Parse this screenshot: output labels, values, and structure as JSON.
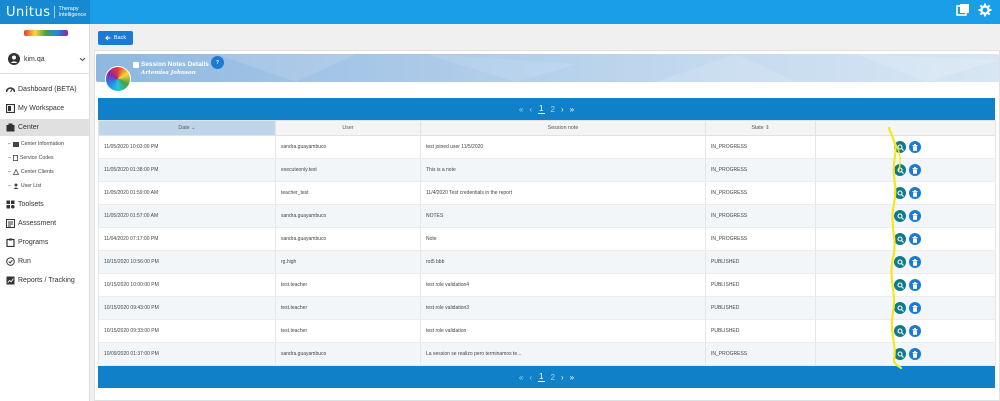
{
  "brand": {
    "name": "Unitus",
    "sub_line1": "Therapy",
    "sub_line2": "Intelligence"
  },
  "sidebar": {
    "username": "kim.qa",
    "items": [
      {
        "label": "Dashboard (BETA)",
        "icon": "dashboard-icon"
      },
      {
        "label": "My Workspace",
        "icon": "workspace-icon"
      },
      {
        "label": "Center",
        "icon": "center-icon"
      },
      {
        "label": "Toolsets",
        "icon": "toolsets-icon"
      },
      {
        "label": "Assessment",
        "icon": "assessment-icon"
      },
      {
        "label": "Programs",
        "icon": "programs-icon"
      },
      {
        "label": "Run",
        "icon": "run-icon"
      },
      {
        "label": "Reports / Tracking",
        "icon": "reports-icon"
      }
    ],
    "center_subitems": [
      {
        "label": "Center Information"
      },
      {
        "label": "Service Codes"
      },
      {
        "label": "Center Clients"
      },
      {
        "label": "User List"
      }
    ]
  },
  "toolbar": {
    "back_label": "Back"
  },
  "header": {
    "title": "Session Notes Details",
    "patient": "Artemisa Johnson",
    "help": "?"
  },
  "pagination": {
    "first": "«",
    "prev": "‹",
    "pages": [
      "1",
      "2"
    ],
    "next": "›",
    "last": "»"
  },
  "table": {
    "columns": {
      "date": "Date",
      "user": "User",
      "note": "Session note",
      "state": "State"
    },
    "rows": [
      {
        "date": "11/05/2020 10:03:00 PM",
        "user": "sandra.guayambuco",
        "note": "test joined user 11/5/2020",
        "state": "IN_PROGRESS"
      },
      {
        "date": "11/05/2020 01:38:00 PM",
        "user": "executeonly.test",
        "note": "This is a note",
        "state": "IN_PROGRESS"
      },
      {
        "date": "11/05/2020 01:59:00 AM",
        "user": "teacher_test",
        "note": "11/4/2020 Test credentials in the report",
        "state": "IN_PROGRESS"
      },
      {
        "date": "11/05/2020 01:57:00 AM",
        "user": "sandra.guayambuco",
        "note": "NOTES",
        "state": "IN_PROGRESS"
      },
      {
        "date": "11/04/2020 07:17:00 PM",
        "user": "sandra.guayambuco",
        "note": "Note",
        "state": "IN_PROGRESS"
      },
      {
        "date": "10/15/2020 10:56:00 PM",
        "user": "rg.high",
        "note": "rot5 bbb",
        "state": "PUBLISHED"
      },
      {
        "date": "10/15/2020 10:00:00 PM",
        "user": "test.teacher",
        "note": "test role validation4",
        "state": "PUBLISHED"
      },
      {
        "date": "10/15/2020 09:43:00 PM",
        "user": "test.teacher",
        "note": "test role validation3",
        "state": "PUBLISHED"
      },
      {
        "date": "10/15/2020 09:33:00 PM",
        "user": "test.teacher",
        "note": "test role validation",
        "state": "PUBLISHED"
      },
      {
        "date": "10/09/2020 01:37:00 PM",
        "user": "sandra.guayambuco",
        "note": "La session se realizo pero terminamos te...",
        "state": "IN_PROGRESS"
      }
    ]
  },
  "colors": {
    "topbar": "#1b9ee8",
    "pager": "#1080c8",
    "view_button": "#0e7b8a",
    "delete_button": "#1b7bd4",
    "annotation": "#f5e71a"
  }
}
